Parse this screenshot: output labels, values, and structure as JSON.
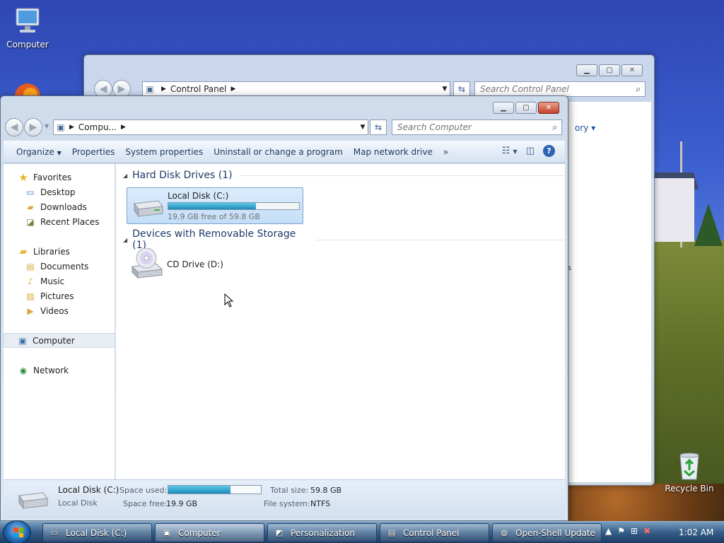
{
  "desktop": {
    "computer_label": "Computer",
    "recycle_label": "Recycle Bin"
  },
  "back_window": {
    "address": "Control Panel",
    "search_placeholder": "Search Control Panel",
    "peek_link": "ory",
    "peek_text": "s"
  },
  "window": {
    "address": "Compu...",
    "search_placeholder": "Search Computer",
    "toolbar": [
      "Organize",
      "Properties",
      "System properties",
      "Uninstall or change a program",
      "Map network drive"
    ],
    "toolbar_more": "»",
    "nav": {
      "favorites": "Favorites",
      "desktop": "Desktop",
      "downloads": "Downloads",
      "recent": "Recent Places",
      "libraries": "Libraries",
      "documents": "Documents",
      "music": "Music",
      "pictures": "Pictures",
      "videos": "Videos",
      "computer": "Computer",
      "network": "Network"
    },
    "groups": {
      "hdd": "Hard Disk Drives (1)",
      "removable": "Devices with Removable Storage (1)"
    },
    "drive_c": {
      "name": "Local Disk (C:)",
      "free": "19.9 GB free of 59.8 GB",
      "used_fraction": 0.67
    },
    "drive_d": {
      "name": "CD Drive (D:)"
    },
    "details": {
      "name": "Local Disk (C:)",
      "type": "Local Disk",
      "space_used_label": "Space used:",
      "space_free_label": "Space free:",
      "space_free": "19.9 GB",
      "total_size_label": "Total size:",
      "total_size": "59.8 GB",
      "file_system_label": "File system:",
      "file_system": "NTFS"
    }
  },
  "taskbar": {
    "buttons": [
      "Local Disk (C:)",
      "Computer",
      "Personalization",
      "Control Panel",
      "Open-Shell Update"
    ],
    "clock": "1:02 AM"
  }
}
